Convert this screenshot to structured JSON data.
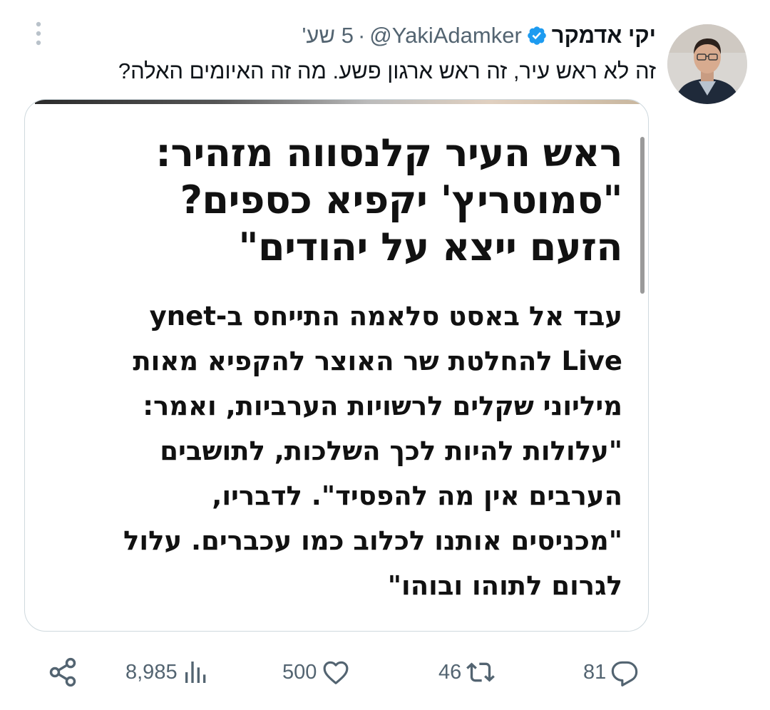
{
  "author": {
    "display_name": "יקי אדמקר",
    "handle": "@YakiAdamker",
    "separator": "·",
    "time": "5 שע'",
    "verified": true
  },
  "tweet": {
    "text": "זה לא ראש עיר, זה ראש ארגון פשע. מה זה האיומים האלה?"
  },
  "media": {
    "headline_lines": [
      "ראש העיר קלנסווה מזהיר:",
      "\"סמוטריץ' יקפיא כספים?",
      "הזעם ייצא על יהודים\""
    ],
    "body_lines": [
      "עבד אל באסט סלאמה התייחס ב-ynet",
      "Live להחלטת שר האוצר להקפיא מאות",
      "מיליוני שקלים לרשויות הערביות, ואמר:",
      "\"עלולות להיות לכך השלכות, לתושבים",
      "הערבים אין מה להפסיד\". לדבריו,",
      "\"מכניסים אותנו לכלוב כמו עכברים. עלול",
      "לגרום לתוהו ובוהו\""
    ]
  },
  "actions": {
    "replies": "81",
    "retweets": "46",
    "likes": "500",
    "views": "8,985"
  },
  "icons": {
    "verified": "verified-badge-icon",
    "more": "more-vertical-icon",
    "reply": "reply-icon",
    "retweet": "retweet-icon",
    "like": "heart-icon",
    "views": "views-icon",
    "share": "share-icon"
  },
  "colors": {
    "verified_blue": "#1d9bf0",
    "secondary_text": "#536471",
    "border": "#cfd9de"
  }
}
